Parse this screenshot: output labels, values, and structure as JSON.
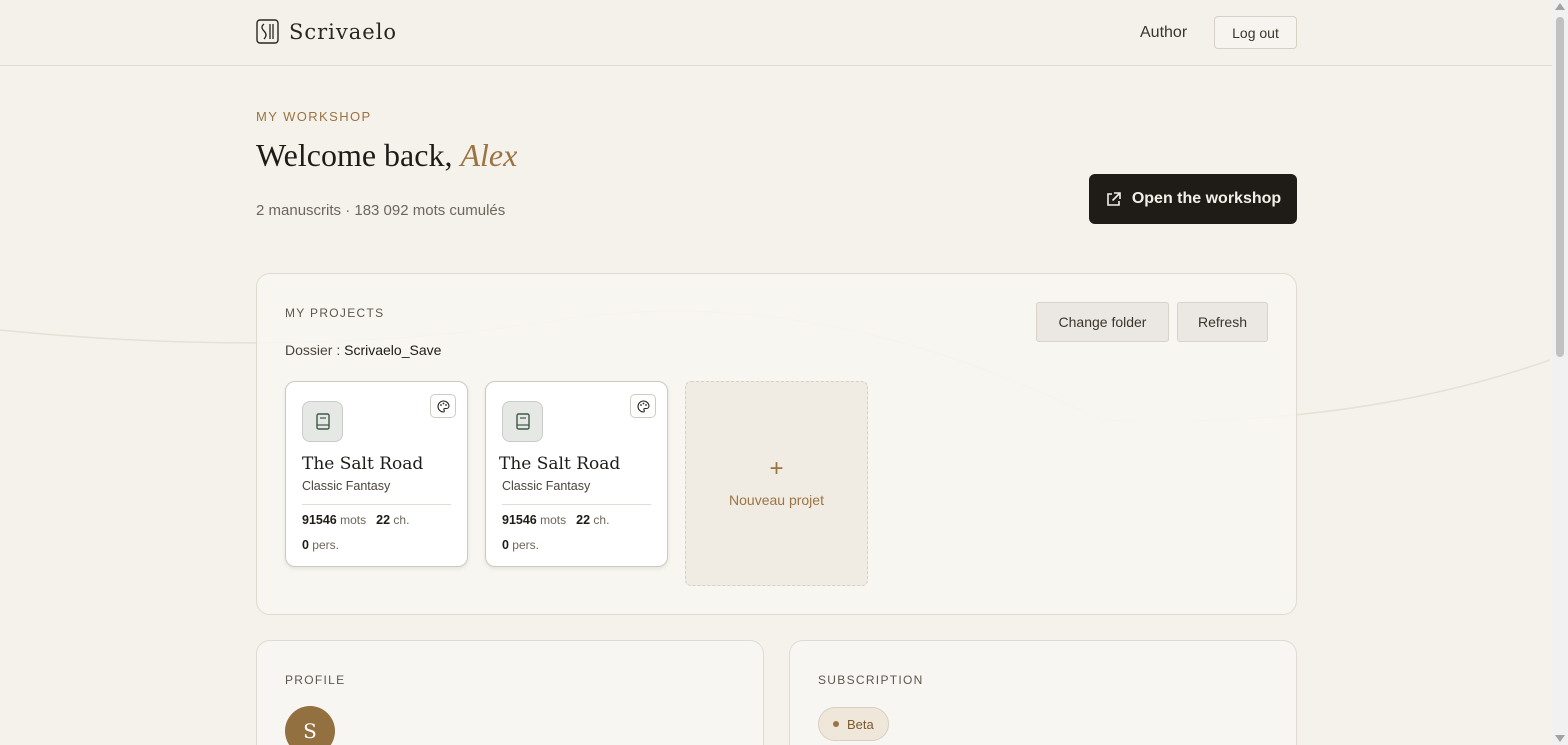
{
  "header": {
    "brand": "Scrivaelo",
    "nav_author": "Author",
    "logout_label": "Log out"
  },
  "hero": {
    "eyebrow": "MY WORKSHOP",
    "welcome_prefix": "Welcome back,",
    "user_name": "Alex",
    "stats": "2 manuscrits · 183 092 mots cumulés",
    "open_label": "Open the workshop"
  },
  "projects": {
    "title": "MY PROJECTS",
    "folder_label": "Dossier :",
    "folder_value": "Scrivaelo_Save",
    "change_folder_label": "Change folder",
    "refresh_label": "Refresh",
    "cards": [
      {
        "title": "The Salt Road",
        "genre": "Classic Fantasy",
        "words": "91546",
        "words_unit": "mots",
        "chapters": "22",
        "chapters_unit": "ch.",
        "characters": "0",
        "characters_unit": "pers."
      },
      {
        "title": "The Salt Road",
        "genre": "Classic Fantasy",
        "words": "91546",
        "words_unit": "mots",
        "chapters": "22",
        "chapters_unit": "ch.",
        "characters": "0",
        "characters_unit": "pers."
      }
    ],
    "new_plus": "+",
    "new_label": "Nouveau projet"
  },
  "profile": {
    "title": "PROFILE",
    "avatar_initial": "S"
  },
  "subscription": {
    "title": "SUBSCRIPTION",
    "badge": "Beta"
  }
}
